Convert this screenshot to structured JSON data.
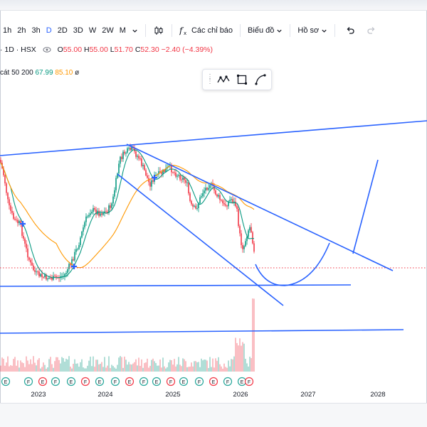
{
  "toolbar": {
    "intervals": [
      "1h",
      "2h",
      "3h",
      "D",
      "2D",
      "3D",
      "W",
      "2W",
      "M"
    ],
    "active_interval": "D",
    "indicators_label": "Các chỉ báo",
    "chart_type_label": "Biểu đồ",
    "profile_label": "Hồ sơ"
  },
  "legend": {
    "symbol_prefix": "·",
    "symbol": "1D · HSX",
    "open_label": "O",
    "open": "55.00",
    "high_label": "H",
    "high": "55.00",
    "low_label": "L",
    "low": "51.70",
    "close_label": "C",
    "close": "52.30",
    "change": "−2.40 (−4.39%)",
    "ma_label": "cát 50 200",
    "ma1": "67.99",
    "ma2": "85.10",
    "ma_end": "ø"
  },
  "axis": {
    "years": [
      "2023",
      "2024",
      "2025",
      "2026",
      "2027",
      "2028"
    ]
  },
  "colors": {
    "trendline": "#2962ff",
    "up": "#089981",
    "down": "#f23645",
    "ma_fast": "#089981",
    "ma_slow": "#ff9800",
    "earnings_badge": "#26a69a"
  },
  "chart_data": {
    "type": "candlestick",
    "x_axis_ticks": [
      "2023",
      "2024",
      "2025",
      "2026",
      "2027",
      "2028"
    ],
    "grid": false,
    "legend": "top-left",
    "last_price": 52.3,
    "series": [
      {
        "name": "price",
        "style": "candles"
      },
      {
        "name": "MA 50",
        "value_last": 67.99
      },
      {
        "name": "MA 200",
        "value_last": 85.1
      },
      {
        "name": "volume",
        "style": "bars"
      }
    ],
    "drawings": [
      "upper-trendline",
      "descending-wedge-upper",
      "descending-wedge-lower",
      "support-line",
      "lower-support-line",
      "projected-path"
    ]
  }
}
